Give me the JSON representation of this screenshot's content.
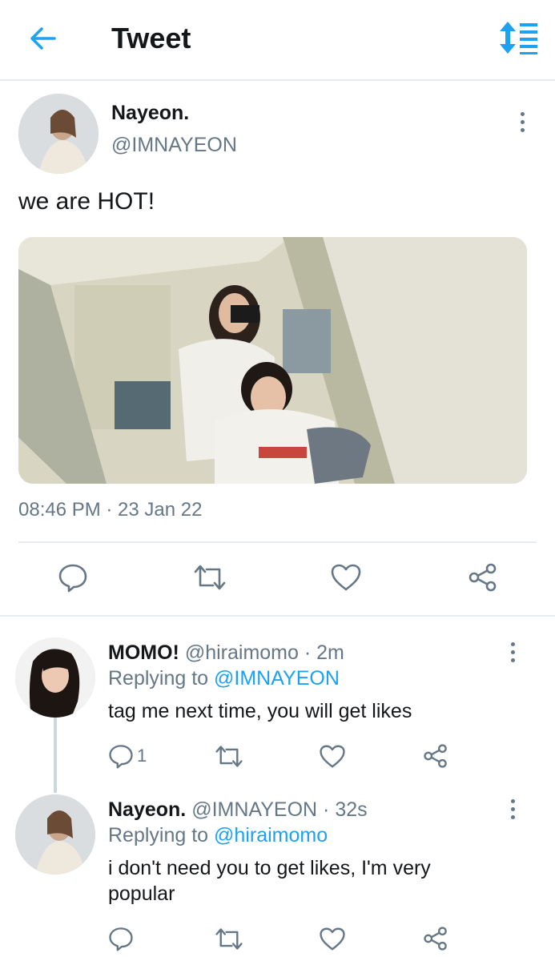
{
  "header": {
    "title": "Tweet",
    "back_icon": "arrow-left-icon",
    "sort_icon": "sort-lines-icon",
    "accent": "#1da1f2"
  },
  "main_tweet": {
    "author_name": "Nayeon.",
    "author_handle": "@IMNAYEON",
    "text": "we are HOT!",
    "timestamp": "08:46 PM · 23 Jan 22",
    "actions": [
      "reply-icon",
      "retweet-icon",
      "like-icon",
      "share-icon"
    ]
  },
  "replies": [
    {
      "author_name": "MOMO!",
      "author_handle": "@hiraimomo",
      "time": "· 2m",
      "replying_label": "Replying to",
      "replying_to": "@IMNAYEON",
      "text": "tag me next time, you will get likes",
      "reply_count": "1"
    },
    {
      "author_name": "Nayeon.",
      "author_handle": "@IMNAYEON",
      "time": "· 32s",
      "replying_label": "Replying to",
      "replying_to": "@hiraimomo",
      "text": "i don't need you to get likes, I'm very popular",
      "reply_count": ""
    }
  ]
}
